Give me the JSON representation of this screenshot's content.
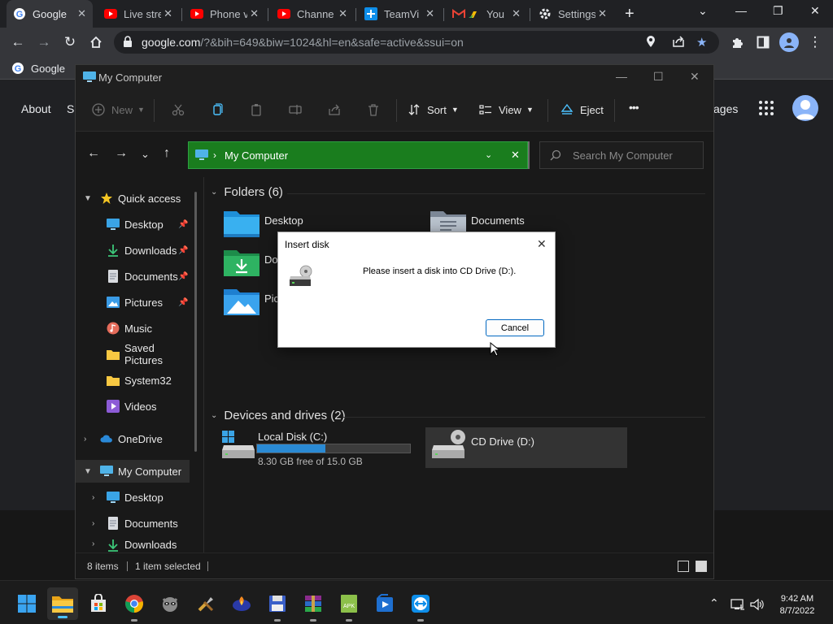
{
  "browser": {
    "tabs": [
      {
        "label": "Google",
        "icon": "google-icon",
        "active": true
      },
      {
        "label": "Live stre",
        "icon": "youtube-icon"
      },
      {
        "label": "Phone v",
        "icon": "youtube-icon"
      },
      {
        "label": "Channel",
        "icon": "youtube-icon"
      },
      {
        "label": "TeamVi",
        "icon": "teamviewer-icon"
      },
      {
        "label": "You",
        "icon": "gmail-drive-icon"
      },
      {
        "label": "Settings",
        "icon": "gear-icon"
      }
    ],
    "url_host": "google.com",
    "url_rest": "/?&bih=649&biw=1024&hl=en&safe=active&ssui=on",
    "bookmark": "Google"
  },
  "google_page": {
    "about": "About",
    "s_partial": "S",
    "images_partial": "ages"
  },
  "explorer": {
    "title": "My Computer",
    "commands": {
      "new": "New",
      "sort": "Sort",
      "view": "View",
      "eject": "Eject",
      "more": "•••"
    },
    "address": "My Computer",
    "search_placeholder": "Search My Computer",
    "sidebar": [
      {
        "label": "Quick access",
        "icon": "star-icon"
      },
      {
        "label": "Desktop",
        "icon": "desktop-icon",
        "pinned": true
      },
      {
        "label": "Downloads",
        "icon": "download-icon",
        "pinned": true
      },
      {
        "label": "Documents",
        "icon": "document-icon",
        "pinned": true
      },
      {
        "label": "Pictures",
        "icon": "pictures-icon",
        "pinned": true
      },
      {
        "label": "Music",
        "icon": "music-icon"
      },
      {
        "label": "Saved Pictures",
        "icon": "folder-icon"
      },
      {
        "label": "System32",
        "icon": "folder-icon"
      },
      {
        "label": "Videos",
        "icon": "videos-icon"
      },
      {
        "label": "OneDrive",
        "icon": "cloud-icon"
      },
      {
        "label": "My Computer",
        "icon": "computer-icon",
        "selected": true
      },
      {
        "label": "Desktop",
        "icon": "desktop-icon"
      },
      {
        "label": "Documents",
        "icon": "document-icon"
      },
      {
        "label": "Downloads",
        "icon": "download-icon"
      }
    ],
    "folders_heading": "Folders (6)",
    "folders": [
      {
        "label": "Desktop"
      },
      {
        "label": "Documents"
      },
      {
        "label": "Do"
      },
      {
        "label": "Pic"
      }
    ],
    "drives_heading": "Devices and drives (2)",
    "drives": [
      {
        "label": "Local Disk (C:)",
        "free": "8.30 GB free of 15.0 GB",
        "used_fraction": 0.447
      },
      {
        "label": "CD Drive (D:)"
      }
    ],
    "status": {
      "items": "8 items",
      "selected": "1 item selected"
    }
  },
  "dialog": {
    "title": "Insert disk",
    "message": "Please insert a disk into CD Drive (D:).",
    "cancel": "Cancel"
  },
  "taskbar": {
    "time": "9:42 AM",
    "date": "8/7/2022"
  },
  "colors": {
    "address_green": "#1a7d1e",
    "accent_blue": "#0067c0",
    "drive_fill": "#2a8ad4"
  }
}
